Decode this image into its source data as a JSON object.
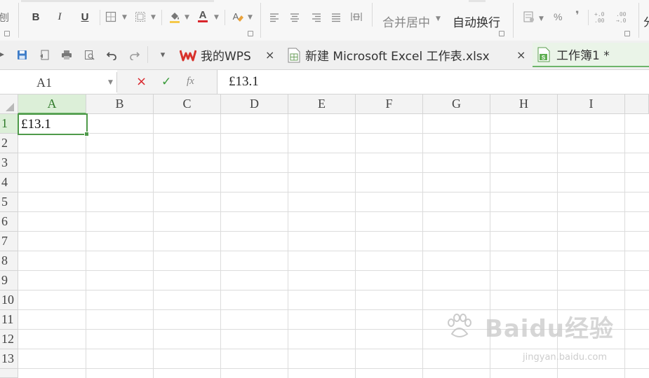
{
  "ribbon": {
    "left_edge_glyph": "刨",
    "bold": "B",
    "italic": "I",
    "underline": "U",
    "merge_center_label": "合并居中",
    "wrap_text_label": "自动换行",
    "percent": "%",
    "comma": "❜",
    "inc_decimal": "+.0 .00",
    "dec_decimal": ".00 →.0",
    "right_edge_glyph": "分"
  },
  "quick_access": {
    "overflow_glyph": "▾"
  },
  "tabs": [
    {
      "label": "我的WPS",
      "close": "×"
    },
    {
      "label": "新建 Microsoft Excel 工作表.xlsx",
      "close": "×"
    },
    {
      "label": "工作簿1 *"
    }
  ],
  "formula_bar": {
    "name_box": "A1",
    "cancel": "×",
    "confirm": "✓",
    "fx": "fx",
    "content": "£13.1"
  },
  "sheet": {
    "columns": [
      "A",
      "B",
      "C",
      "D",
      "E",
      "F",
      "G",
      "H",
      "I"
    ],
    "rows": [
      "1",
      "2",
      "3",
      "4",
      "5",
      "6",
      "7",
      "8",
      "9",
      "10",
      "11",
      "12",
      "13"
    ],
    "active_cell": "A1",
    "cell_a1": "£13.1"
  },
  "watermark": {
    "brand": "Baidu经验",
    "url": "jingyan.baidu.com"
  },
  "colors": {
    "accent_green": "#6db56a",
    "selected_header": "#dcefd8",
    "font_color_red": "#d9262c",
    "wps_red": "#d8322b"
  }
}
